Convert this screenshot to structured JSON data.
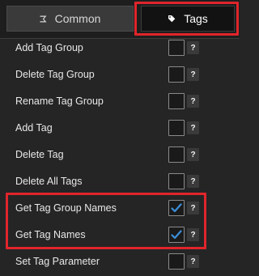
{
  "tabs": [
    {
      "label": "Common",
      "icon": "funnel-icon",
      "selected": false
    },
    {
      "label": "Tags",
      "icon": "tag-icon",
      "selected": true
    }
  ],
  "actions": [
    {
      "label": "Add Tag Group",
      "checked": false,
      "help": "?"
    },
    {
      "label": "Delete Tag Group",
      "checked": false,
      "help": "?"
    },
    {
      "label": "Rename Tag Group",
      "checked": false,
      "help": "?"
    },
    {
      "label": "Add Tag",
      "checked": false,
      "help": "?"
    },
    {
      "label": "Delete Tag",
      "checked": false,
      "help": "?"
    },
    {
      "label": "Delete All Tags",
      "checked": false,
      "help": "?"
    },
    {
      "label": "Get Tag Group Names",
      "checked": true,
      "help": "?"
    },
    {
      "label": "Get Tag Names",
      "checked": true,
      "help": "?"
    },
    {
      "label": "Set Tag Parameter",
      "checked": false,
      "help": "?"
    }
  ],
  "colors": {
    "highlight": "#e0252b",
    "checkmark": "#3b8fd9",
    "background": "#252526"
  }
}
